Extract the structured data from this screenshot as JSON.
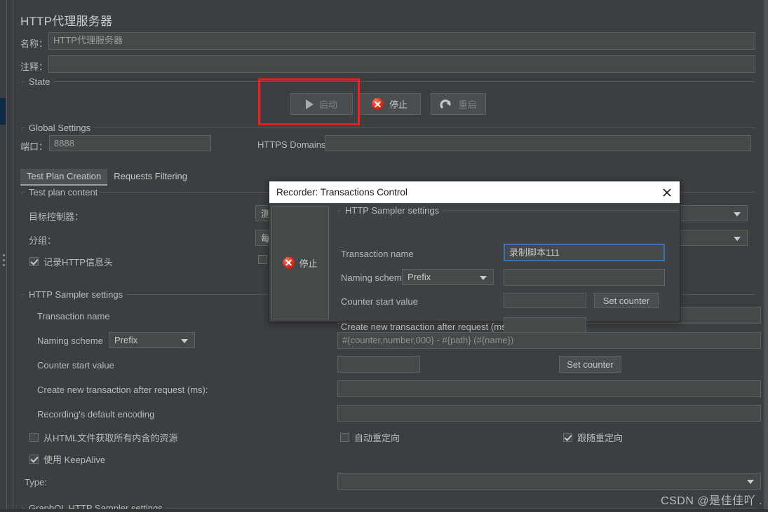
{
  "window": {
    "title": "HTTP代理服务器"
  },
  "form": {
    "name_label": "名称：",
    "name_value": "HTTP代理服务器",
    "comment_label": "注释：",
    "comment_value": ""
  },
  "state_group": {
    "legend": "State",
    "start_button": "启动",
    "stop_button": "停止",
    "restart_button": "重启",
    "start_icon": "play-icon",
    "stop_icon": "stop-octagon-icon",
    "restart_icon": "restart-arrow-icon",
    "highlight_color": "#ff1a1a"
  },
  "global_settings": {
    "legend": "Global Settings",
    "port_label": "端口：",
    "port_value": "8888",
    "https_domains_label": "HTTPS Domains:",
    "https_domains_value": ""
  },
  "tabs": [
    {
      "label": "Test Plan Creation",
      "active": true
    },
    {
      "label": "Requests Filtering",
      "active": false
    }
  ],
  "test_plan_content": {
    "legend": "Test plan content",
    "target_controller_label": "目标控制器：",
    "target_controller_value": "测",
    "grouping_label": "分组：",
    "grouping_value": "每",
    "capture_headers_label": "记录HTTP信息头",
    "capture_headers_checked": true,
    "second_checkbox_checked": false
  },
  "http_sampler_settings": {
    "legend": "HTTP Sampler settings",
    "transaction_name_label": "Transaction name",
    "transaction_name_value": "",
    "naming_scheme_label": "Naming scheme",
    "naming_scheme_value": "Prefix",
    "naming_scheme_pattern_placeholder": "#{counter,number,000} - #{path} (#{name})",
    "counter_start_label": "Counter start value",
    "counter_start_value": "",
    "set_counter_button": "Set counter",
    "create_new_transaction_label": "Create new transaction after request (ms):",
    "create_new_transaction_value": "",
    "recording_encoding_label": "Recording's default encoding",
    "recording_encoding_value": "",
    "retrieve_embedded_label": "从HTML文件获取所有内含的资源",
    "retrieve_embedded_checked": false,
    "keepalive_label": "使用 KeepAlive",
    "keepalive_checked": true,
    "auto_redirect_label": "自动重定向",
    "auto_redirect_checked": false,
    "follow_redirect_label": "跟随重定向",
    "follow_redirect_checked": true,
    "type_label": "Type:",
    "type_value": ""
  },
  "graphql_settings": {
    "legend": "GraphQL HTTP Sampler settings"
  },
  "dialog": {
    "title": "Recorder: Transactions Control",
    "close_icon": "close-x-icon",
    "stop_button": "停止",
    "stop_icon": "stop-octagon-icon",
    "legend": "HTTP Sampler settings",
    "transaction_name_label": "Transaction name",
    "transaction_name_value": "录制脚本111",
    "naming_scheme_label": "Naming scheme",
    "naming_scheme_value": "Prefix",
    "naming_scheme_pattern_value": "",
    "counter_start_label": "Counter start value",
    "counter_start_value": "",
    "set_counter_button": "Set counter",
    "create_new_transaction_label": "Create new transaction after request (ms):",
    "create_new_transaction_value": "",
    "focus_border_color": "#3a74ab"
  },
  "watermark": {
    "text": "CSDN @是佳佳吖  ."
  }
}
